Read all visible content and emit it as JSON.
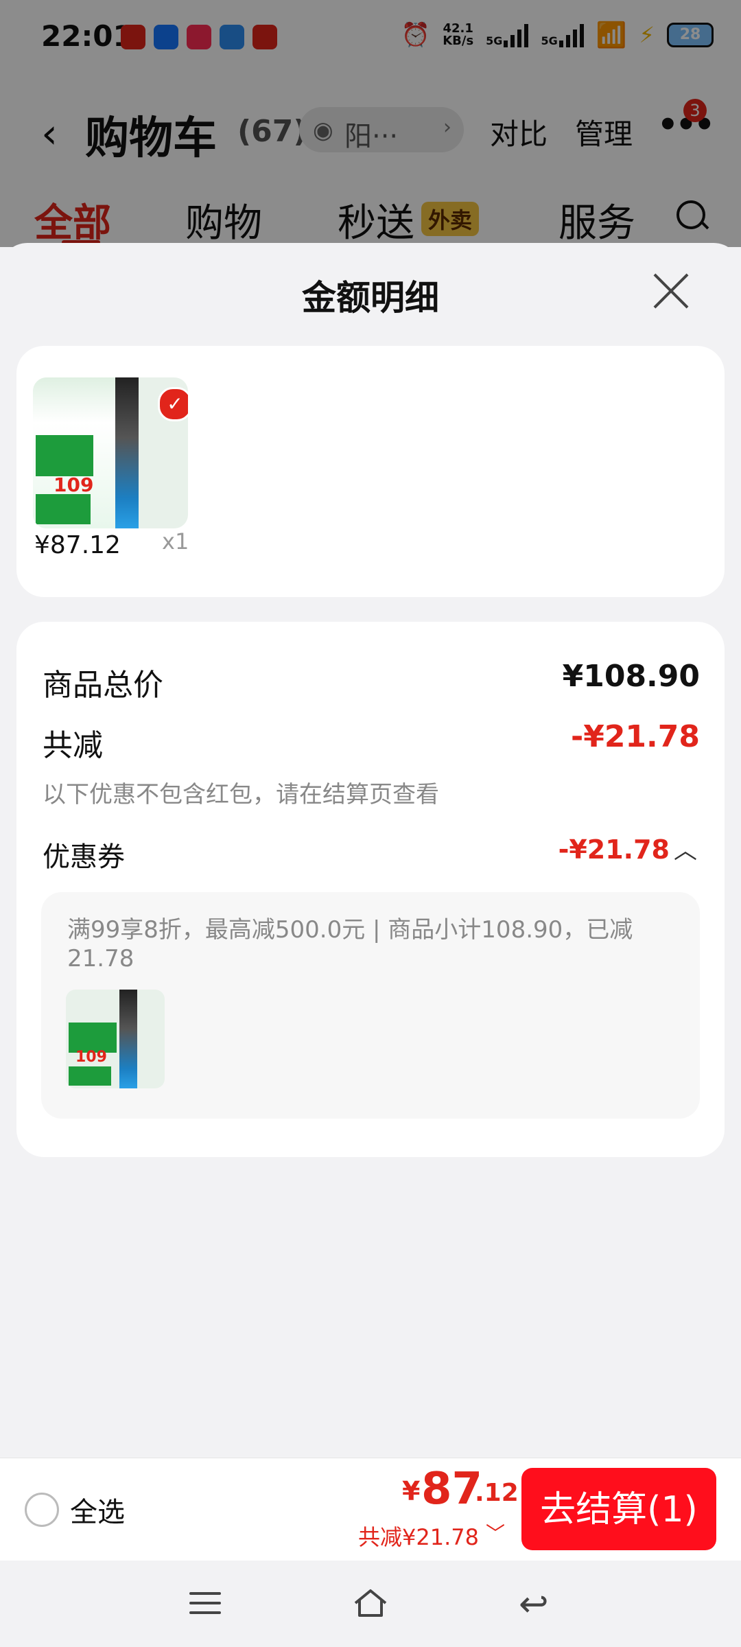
{
  "status_bar": {
    "time": "22:01",
    "net_speed_value": "42.1",
    "net_speed_unit": "KB/s",
    "signal1": "5G",
    "signal2": "5G",
    "battery": "28"
  },
  "cart_header": {
    "title": "购物车",
    "count": "(67)",
    "address": "阳···",
    "compare": "对比",
    "manage": "管理",
    "more_badge": "3"
  },
  "cart_tabs": {
    "all": "全部",
    "shopping": "购物",
    "instant": "秒送",
    "instant_badge": "外卖",
    "service": "服务"
  },
  "sheet": {
    "title": "金额明细"
  },
  "product": {
    "price": "¥87.12",
    "qty": "x1",
    "thumb_price": "109"
  },
  "breakdown": {
    "total_label": "商品总价",
    "total_value": "¥108.90",
    "reduced_label": "共减",
    "reduced_value": "-¥21.78",
    "note": "以下优惠不包含红包，请在结算页查看",
    "coupon_label": "优惠券",
    "coupon_value": "-¥21.78",
    "coupon_desc": "满99享8折，最高减500.0元 | 商品小计108.90，已减21.78",
    "coupon_thumb_price": "109"
  },
  "bottom_bar": {
    "select_all": "全选",
    "currency": "¥",
    "total_int": "87",
    "total_dec": ".12",
    "saved": "共减¥21.78",
    "checkout": "去结算(1)"
  },
  "colors": {
    "accent_red": "#e1251b",
    "checkout_red": "#ff0e1c"
  },
  "icons": [
    "back-chevron-icon",
    "eye-icon",
    "more-icon",
    "search-icon",
    "close-icon",
    "check-icon",
    "chevron-up-icon",
    "chevron-down-icon",
    "menu-icon",
    "home-icon",
    "back-icon"
  ]
}
